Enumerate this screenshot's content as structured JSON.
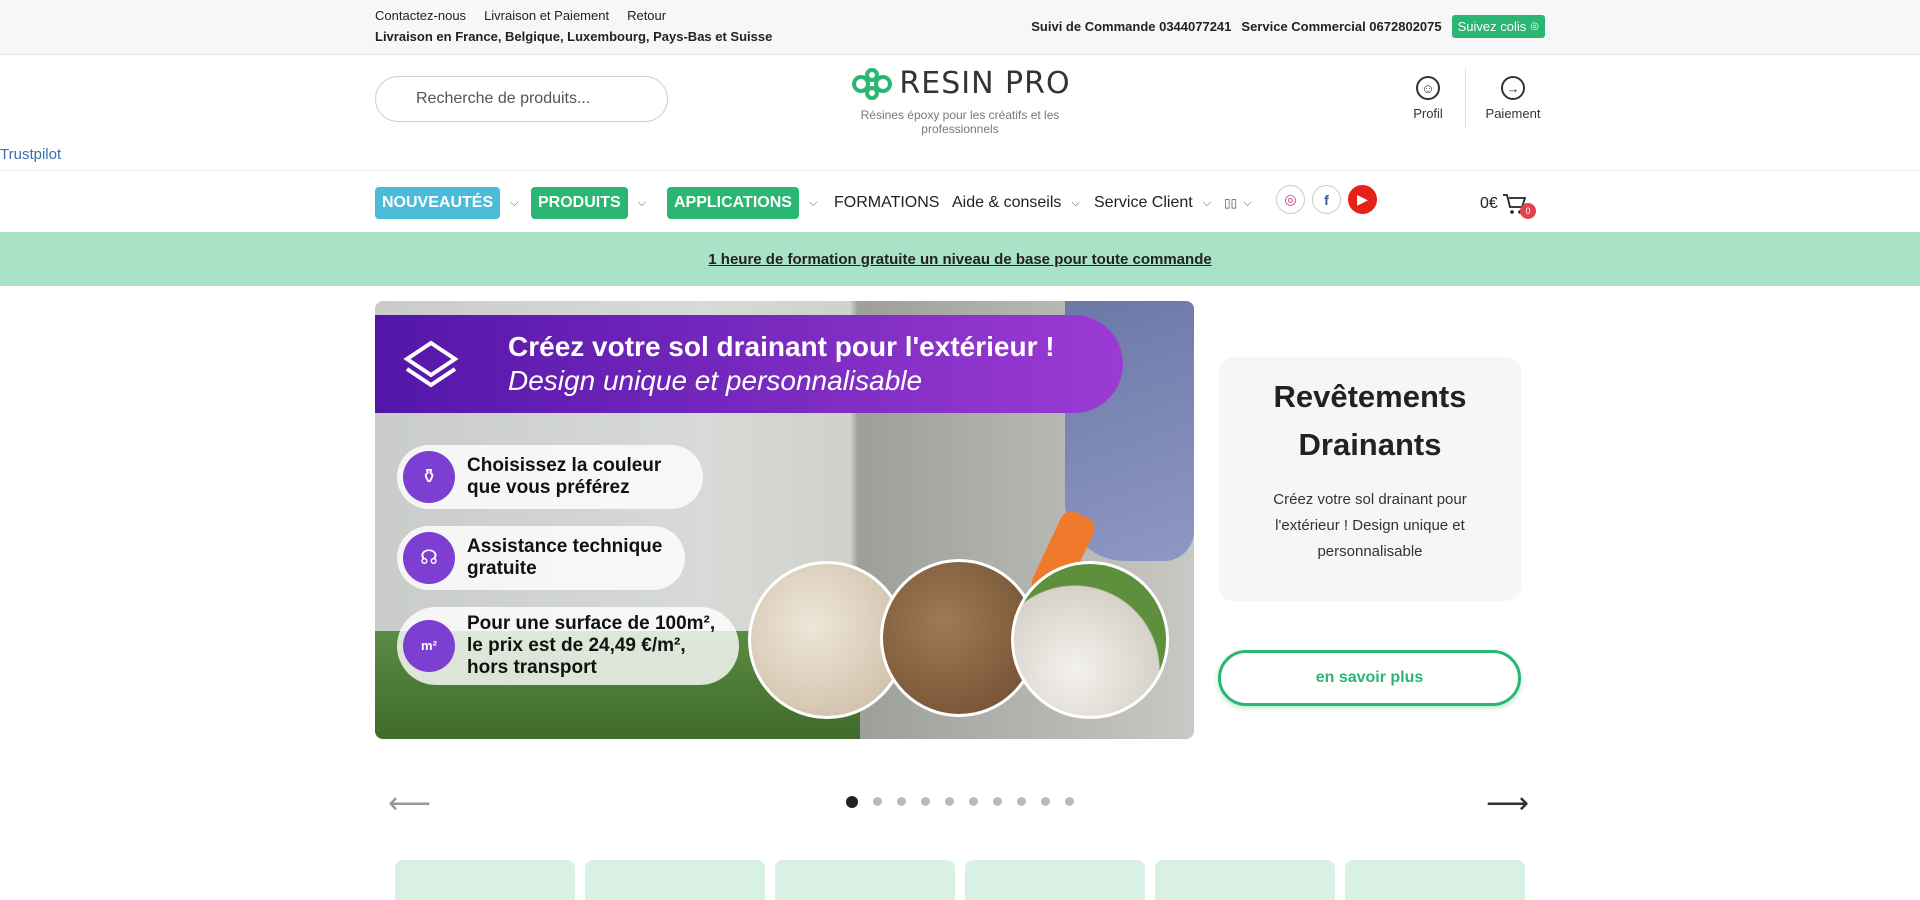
{
  "topbar": {
    "links": [
      "Contactez-nous",
      "Livraison et Paiement",
      "Retour"
    ],
    "shipping": "Livraison en France, Belgique, Luxembourg, Pays-Bas et Suisse",
    "order_tracking": "Suivi de Commande 0344077241",
    "commercial": "Service Commercial 0672802075",
    "track_button": "Suivez colis"
  },
  "header": {
    "search_placeholder": "Recherche de produits...",
    "logo_text": "RESIN PRO",
    "tagline": "Résines époxy pour les créatifs et les professionnels",
    "profile": "Profil",
    "payment": "Paiement",
    "trustpilot": "Trustpilot"
  },
  "nav": {
    "nouveautes": "NOUVEAUTÉS",
    "produits": "PRODUITS",
    "applications": "APPLICATIONS",
    "formations": "FORMATIONS",
    "aide": "Aide & conseils",
    "service": "Service Client",
    "cart_total": "0€",
    "cart_count": "0"
  },
  "promo": "1 heure de formation gratuite un niveau de base pour toute commande",
  "hero": {
    "title": "Créez votre sol drainant pour l'extérieur !",
    "subtitle": "Design unique et personnalisable",
    "features": [
      "Choisissez la couleur que vous préférez",
      "Assistance technique gratuite",
      "Pour une surface de 100m², le prix est de 24,49 €/m², hors transport"
    ]
  },
  "card": {
    "title": "Revêtements Drainants",
    "text": "Créez votre sol drainant pour l'extérieur ! Design unique et personnalisable",
    "cta": "en savoir plus"
  },
  "carousel": {
    "slides": 10,
    "active": 1
  },
  "colors": {
    "accent_green": "#2bb673",
    "accent_blue": "#4cbbd8",
    "promo_bg": "#a9e2c7",
    "hero_purple": "#7c3fd1"
  }
}
